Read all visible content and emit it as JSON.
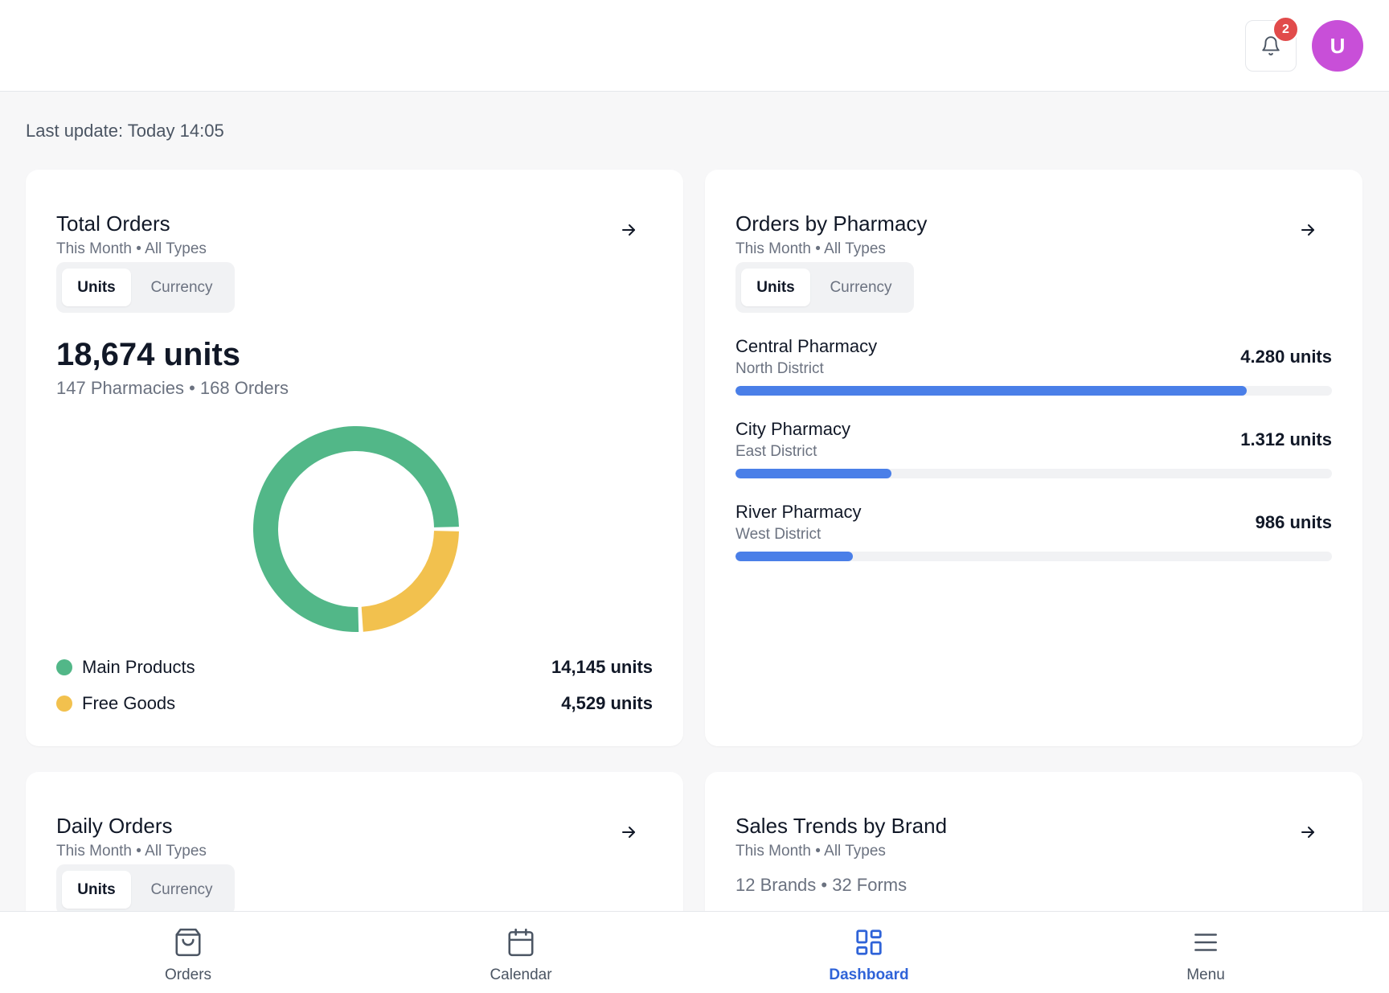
{
  "header": {
    "notifications_count": "2",
    "avatar_initial": "U"
  },
  "last_update": "Last update: Today 14:05",
  "toggle": {
    "units": "Units",
    "currency": "Currency"
  },
  "total_orders": {
    "title": "Total Orders",
    "subtitle": "This Month • All Types",
    "value": "18,674 units",
    "summary": "147 Pharmacies • 168 Orders",
    "legend": [
      {
        "label": "Main Products",
        "value": "14,145 units",
        "color": "#52b788"
      },
      {
        "label": "Free Goods",
        "value": "4,529 units",
        "color": "#f2c14e"
      }
    ]
  },
  "chart_data": {
    "type": "pie",
    "categories": [
      "Main Products",
      "Free Goods"
    ],
    "values": [
      14145,
      4529
    ],
    "colors": [
      "#52b788",
      "#f2c14e"
    ]
  },
  "orders_by_pharmacy": {
    "title": "Orders by Pharmacy",
    "subtitle": "This Month • All Types",
    "items": [
      {
        "name": "Central Pharmacy",
        "district": "North District",
        "value": "4.280 units",
        "fraction": 0.857
      },
      {
        "name": "City Pharmacy",
        "district": "East District",
        "value": "1.312 units",
        "fraction": 0.262
      },
      {
        "name": "River Pharmacy",
        "district": "West District",
        "value": "986 units",
        "fraction": 0.197
      }
    ]
  },
  "daily_orders": {
    "title": "Daily Orders",
    "subtitle": "This Month • All Types"
  },
  "sales_trends": {
    "title": "Sales Trends by Brand",
    "subtitle": "This Month • All Types",
    "summary": "12 Brands • 32 Forms"
  },
  "bottom_nav": {
    "orders": "Orders",
    "calendar": "Calendar",
    "dashboard": "Dashboard",
    "menu": "Menu"
  }
}
